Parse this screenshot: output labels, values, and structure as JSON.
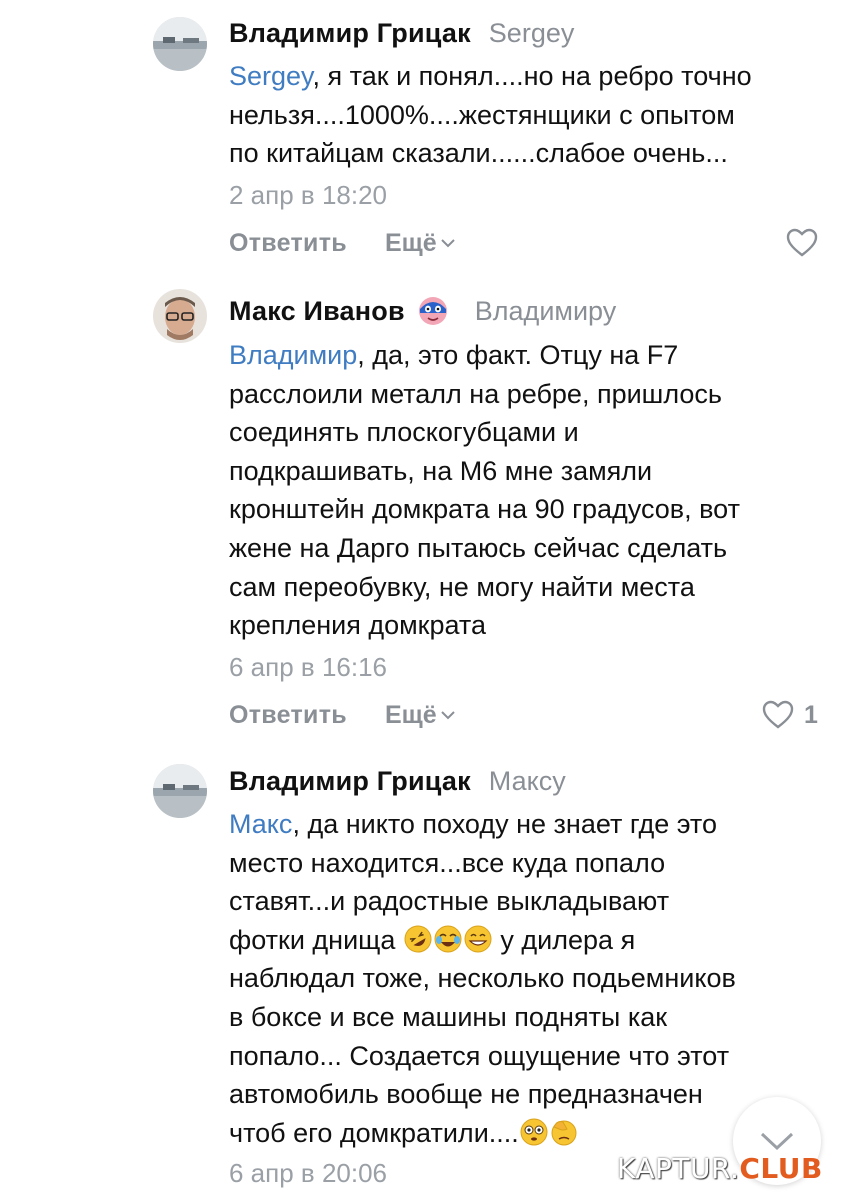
{
  "comments": [
    {
      "author": "Владимир Грицак",
      "reply_to": "Sergey",
      "mention": "Sergey",
      "text_lines": [
        ", я так и понял....но на ребро точно",
        "нельзя....1000%....жестянщики с опытом",
        "по китайцам сказали......слабое очень..."
      ],
      "date": "2 апр в 18:20",
      "reply_label": "Ответить",
      "more_label": "Ещё",
      "likes": ""
    },
    {
      "author": "Макс Иванов",
      "reply_to": "Владимиру",
      "mention": "Владимир",
      "text_lines": [
        ", да, это факт. Отцу на F7",
        "расслоили металл на ребре, пришлось",
        "соединять плоскогубцами и",
        "подкрашивать, на М6 мне замяли",
        "кронштейн домкрата на 90 градусов, вот",
        "жене на Дарго пытаюсь сейчас сделать",
        "сам переобувку, не могу найти места",
        "крепления домкрата"
      ],
      "date": "6 апр в 16:16",
      "reply_label": "Ответить",
      "more_label": "Ещё",
      "likes": "1"
    },
    {
      "author": "Владимир Грицак",
      "reply_to": "Максу",
      "mention": "Макс",
      "text_lines": [
        ", да никто походу не знает где это",
        "место находится...все куда попало",
        "ставят...и радостные выкладывают",
        "фотки днища",
        "у дилера я",
        "наблюдал тоже, несколько подьемников",
        "в боксе и все машины подняты как",
        "попало... Создается ощущение что этот",
        "автомобиль вообще не предназначен",
        "чтоб его домкратили...."
      ],
      "date": "6 апр в 20:06"
    }
  ],
  "watermark": {
    "brand": "KAPTUR.",
    "suffix": "CLUB"
  },
  "icons": {
    "heart": "heart-icon",
    "chevron": "chevron-down-icon",
    "scroll": "scroll-down-icon"
  },
  "colors": {
    "mention": "#3f7cc2",
    "secondary": "#8a8f96",
    "watermark_accent": "#e25b1f"
  }
}
